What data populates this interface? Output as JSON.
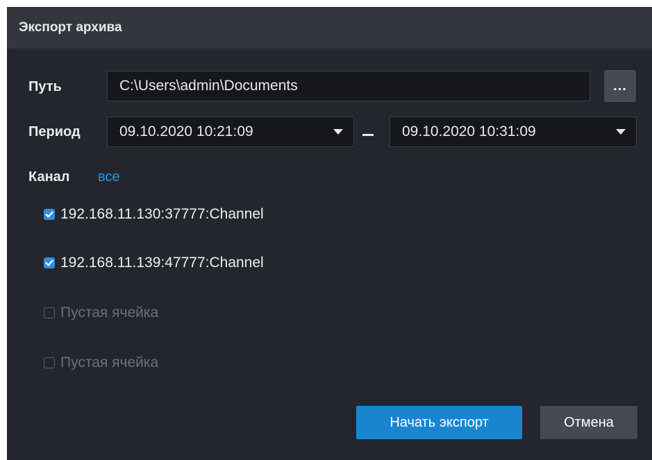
{
  "dialog": {
    "title": "Экспорт архива"
  },
  "path": {
    "label": "Путь",
    "value": "C:\\Users\\admin\\Documents",
    "browse_label": "..."
  },
  "period": {
    "label": "Период",
    "start": "09.10.2020  10:21:09",
    "separator": "–",
    "end": "09.10.2020  10:31:09"
  },
  "channels": {
    "label": "Канал",
    "all_link": "все",
    "items": [
      {
        "label": "192.168.11.130:37777:Channel",
        "checked": true
      },
      {
        "label": "192.168.11.139:47777:Channel",
        "checked": true
      },
      {
        "label": "Пустая ячейка",
        "checked": false
      },
      {
        "label": "Пустая ячейка",
        "checked": false
      }
    ]
  },
  "buttons": {
    "start": "Начать экспорт",
    "cancel": "Отмена"
  },
  "colors": {
    "accent": "#1a85cf",
    "link": "#2a95dc",
    "background": "#24262d",
    "titlebar": "#34363e"
  }
}
